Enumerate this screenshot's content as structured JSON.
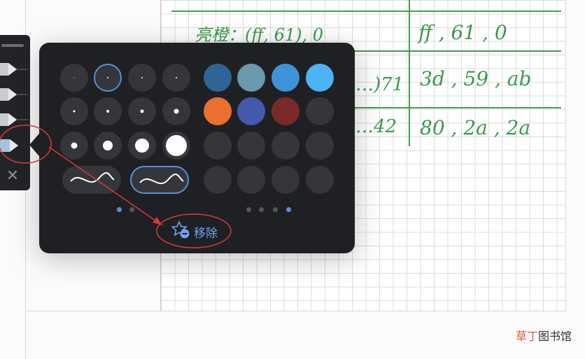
{
  "notebook": {
    "rows": [
      {
        "left": "亮橙：(ff, 61), 0",
        "right": "ff , 61 , 0"
      },
      {
        "left": "…)71",
        "right": "3d , 59 , ab"
      },
      {
        "left": "…42",
        "right": "80 , 2a , 2a"
      }
    ]
  },
  "pen_rail": {
    "pens": [
      "pen-1",
      "pen-2",
      "pen-3",
      "pen-4"
    ],
    "selected_index": 3,
    "close_icon": "✕"
  },
  "popup": {
    "size_page": {
      "selected": 1,
      "page_indicator": {
        "count": 2,
        "active": 0
      }
    },
    "stroke_style": {
      "selected": 1
    },
    "colors": {
      "swatches": [
        "#2e6496",
        "#6a98ad",
        "#3e92d6",
        "#4cb3f5",
        "#e9702f",
        "#4359ad",
        "#7a2a2a",
        "#34363b",
        "#34363b",
        "#34363b",
        "#34363b",
        "#34363b",
        "#34363b",
        "#34363b",
        "#34363b",
        "#34363b"
      ],
      "page_indicator": {
        "count": 4,
        "active": 3
      }
    },
    "remove_label": "移除",
    "accent_color": "#5b8fd6"
  },
  "watermark": {
    "part1": "草丁",
    "part2": "图书馆"
  }
}
